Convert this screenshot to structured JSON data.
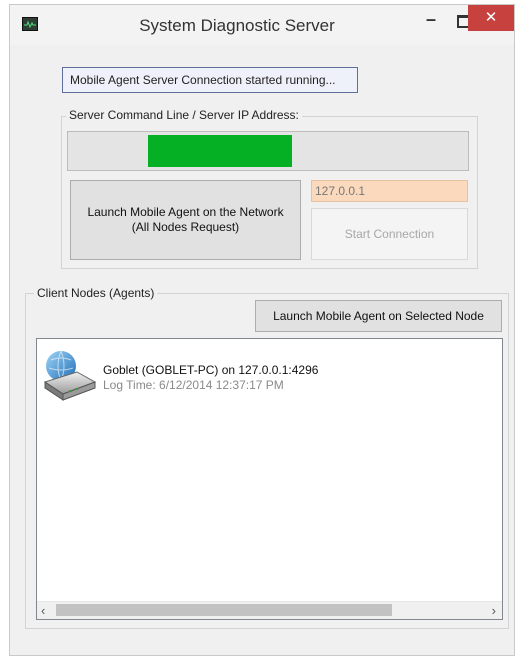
{
  "window": {
    "title": "System Diagnostic Server",
    "minimize_glyph": "–",
    "close_glyph": "✕"
  },
  "status": {
    "message": "Mobile Agent Server Connection started running..."
  },
  "server_group": {
    "label": "Server Command Line / Server IP Address:",
    "progress_percent": 36,
    "launch_all_line1": "Launch Mobile Agent on the Network",
    "launch_all_line2": "(All Nodes Request)",
    "ip_address": "127.0.0.1",
    "start_connection_label": "Start Connection",
    "start_connection_enabled": false
  },
  "clients_group": {
    "label": "Client Nodes (Agents)",
    "launch_selected_label": "Launch Mobile Agent on Selected Node",
    "nodes": [
      {
        "icon": "network-server-icon",
        "title": "Goblet (GOBLET-PC) on 127.0.0.1:4296",
        "log_time": "Log Time: 6/12/2014 12:37:17 PM"
      }
    ]
  },
  "scrollbar": {
    "left_glyph": "‹",
    "right_glyph": "›"
  },
  "colors": {
    "progress_fill": "#06b025",
    "ip_field_bg": "#fbd9bd",
    "close_button": "#c7413e"
  }
}
